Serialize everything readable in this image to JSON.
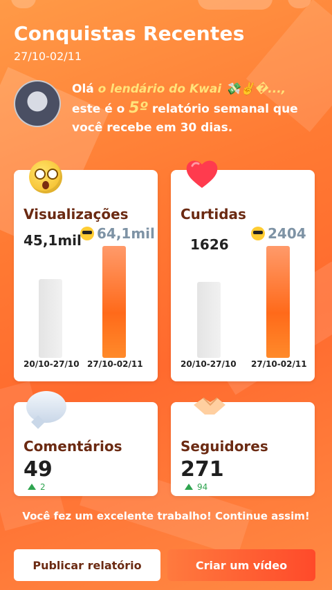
{
  "header": {
    "title": "Conquistas Recentes",
    "date_range": "27/10-02/11"
  },
  "greeting": {
    "prefix": "Olá ",
    "username": "o lendário do Kwai 💸✌️�...,",
    "line2_prefix": "este é o ",
    "report_number": "5º",
    "line2_suffix": " relatório semanal que",
    "line3": "você recebe em 30 dias."
  },
  "cards": {
    "views": {
      "title": "Visualizações",
      "prev_value": "45,1mil",
      "curr_value": "64,1mil",
      "prev_period": "20/10-27/10",
      "curr_period": "27/10-02/11",
      "chart_data": {
        "type": "bar",
        "categories": [
          "20/10-27/10",
          "27/10-02/11"
        ],
        "values": [
          45100,
          64100
        ]
      }
    },
    "likes": {
      "title": "Curtidas",
      "prev_value": "1626",
      "curr_value": "2404",
      "prev_period": "20/10-27/10",
      "curr_period": "27/10-02/11",
      "chart_data": {
        "type": "bar",
        "categories": [
          "20/10-27/10",
          "27/10-02/11"
        ],
        "values": [
          1626,
          2404
        ]
      }
    },
    "comments": {
      "title": "Comentários",
      "value": "49",
      "delta": "2"
    },
    "followers": {
      "title": "Seguidores",
      "value": "271",
      "delta": "94"
    }
  },
  "footer": {
    "message": "Você fez um excelente trabalho! Continue assim!",
    "publish_button": "Publicar relatório",
    "create_button": "Criar um vídeo"
  },
  "colors": {
    "accent": "#ff6a2e",
    "title_brown": "#6b2a12",
    "up_green": "#2ea44f"
  }
}
